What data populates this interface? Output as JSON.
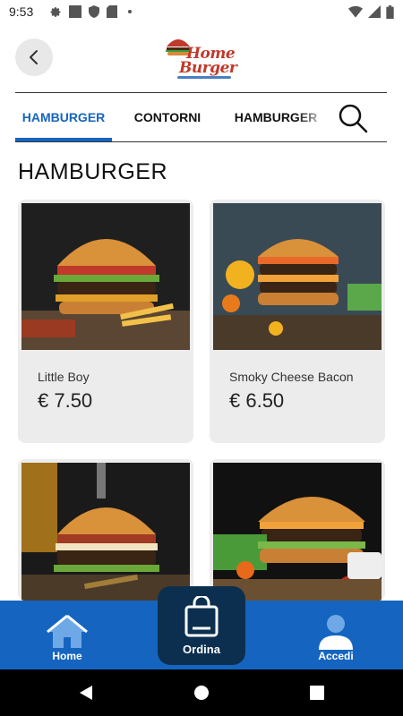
{
  "status": {
    "time": "9:53"
  },
  "header": {
    "logo_line1": "Home",
    "logo_line2": "Burger"
  },
  "tabs": [
    {
      "label": "HAMBURGER",
      "active": true
    },
    {
      "label": "CONTORNI",
      "active": false
    },
    {
      "label": "HAMBURGER",
      "active": false
    }
  ],
  "section_title": "HAMBURGER",
  "products": [
    {
      "name": "Little Boy",
      "price": "€ 7.50"
    },
    {
      "name": "Smoky Cheese Bacon",
      "price": "€ 6.50"
    },
    {
      "name": "",
      "price": ""
    },
    {
      "name": "",
      "price": ""
    }
  ],
  "bottom_nav": {
    "home_label": "Home",
    "order_label": "Ordina",
    "login_label": "Accedi"
  },
  "colors": {
    "accent": "#1565c0",
    "order_button": "#0d2f4f",
    "card_bg": "#ececec"
  }
}
